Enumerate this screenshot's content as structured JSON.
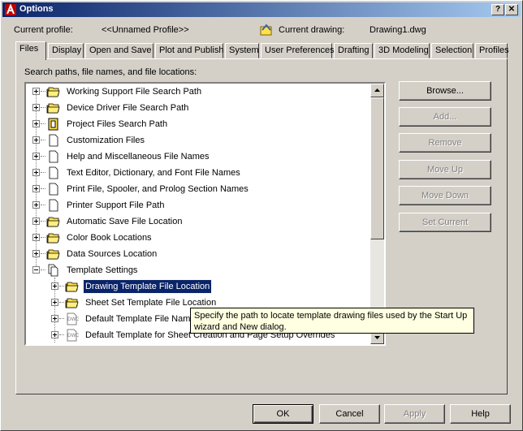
{
  "window": {
    "title": "Options"
  },
  "profile": {
    "label": "Current profile:",
    "value": "<<Unnamed Profile>>"
  },
  "drawing": {
    "label": "Current drawing:",
    "value": "Drawing1.dwg"
  },
  "tabs": [
    "Files",
    "Display",
    "Open and Save",
    "Plot and Publish",
    "System",
    "User Preferences",
    "Drafting",
    "3D Modeling",
    "Selection",
    "Profiles"
  ],
  "active_tab": "Files",
  "section_label": "Search paths, file names, and file locations:",
  "tree": [
    {
      "label": "Working Support File Search Path",
      "icon": "folders-icon",
      "level": 0,
      "expanded": false
    },
    {
      "label": "Device Driver File Search Path",
      "icon": "folders-icon",
      "level": 0,
      "expanded": false
    },
    {
      "label": "Project Files Search Path",
      "icon": "project-icon",
      "level": 0,
      "expanded": false
    },
    {
      "label": "Customization Files",
      "icon": "document-icon",
      "level": 0,
      "expanded": false
    },
    {
      "label": "Help and Miscellaneous File Names",
      "icon": "document-icon",
      "level": 0,
      "expanded": false
    },
    {
      "label": "Text Editor, Dictionary, and Font File Names",
      "icon": "document-icon",
      "level": 0,
      "expanded": false
    },
    {
      "label": "Print File, Spooler, and Prolog Section Names",
      "icon": "document-icon",
      "level": 0,
      "expanded": false
    },
    {
      "label": "Printer Support File Path",
      "icon": "document-icon",
      "level": 0,
      "expanded": false
    },
    {
      "label": "Automatic Save File Location",
      "icon": "folders-icon",
      "level": 0,
      "expanded": false
    },
    {
      "label": "Color Book Locations",
      "icon": "folders-icon",
      "level": 0,
      "expanded": false
    },
    {
      "label": "Data Sources Location",
      "icon": "folders-icon",
      "level": 0,
      "expanded": false
    },
    {
      "label": "Template Settings",
      "icon": "documents-icon",
      "level": 0,
      "expanded": true
    },
    {
      "label": "Drawing Template File Location",
      "icon": "folders-icon",
      "level": 1,
      "expanded": false,
      "selected": true
    },
    {
      "label": "Sheet Set Template File Location",
      "icon": "folders-icon",
      "level": 1,
      "expanded": false
    },
    {
      "label": "Default Template File Name",
      "icon": "dwg-file-icon",
      "level": 1,
      "expanded": false
    },
    {
      "label": "Default Template for Sheet Creation and Page Setup Overrides",
      "icon": "dwg-file-icon",
      "level": 1,
      "expanded": false
    }
  ],
  "side_buttons": {
    "browse": "Browse...",
    "add": "Add...",
    "remove": "Remove",
    "move_up": "Move Up",
    "move_down": "Move Down",
    "set_current": "Set Current"
  },
  "tooltip": "Specify the path to locate template drawing files used by the Start Up wizard and New dialog.",
  "footer_buttons": {
    "ok": "OK",
    "cancel": "Cancel",
    "apply": "Apply",
    "help": "Help"
  },
  "colors": {
    "face": "#d4d0c8",
    "title_start": "#0a246a",
    "title_end": "#a6caf0",
    "selection": "#0a246a",
    "tooltip_bg": "#ffffe1",
    "folder": "#ffe14b"
  }
}
